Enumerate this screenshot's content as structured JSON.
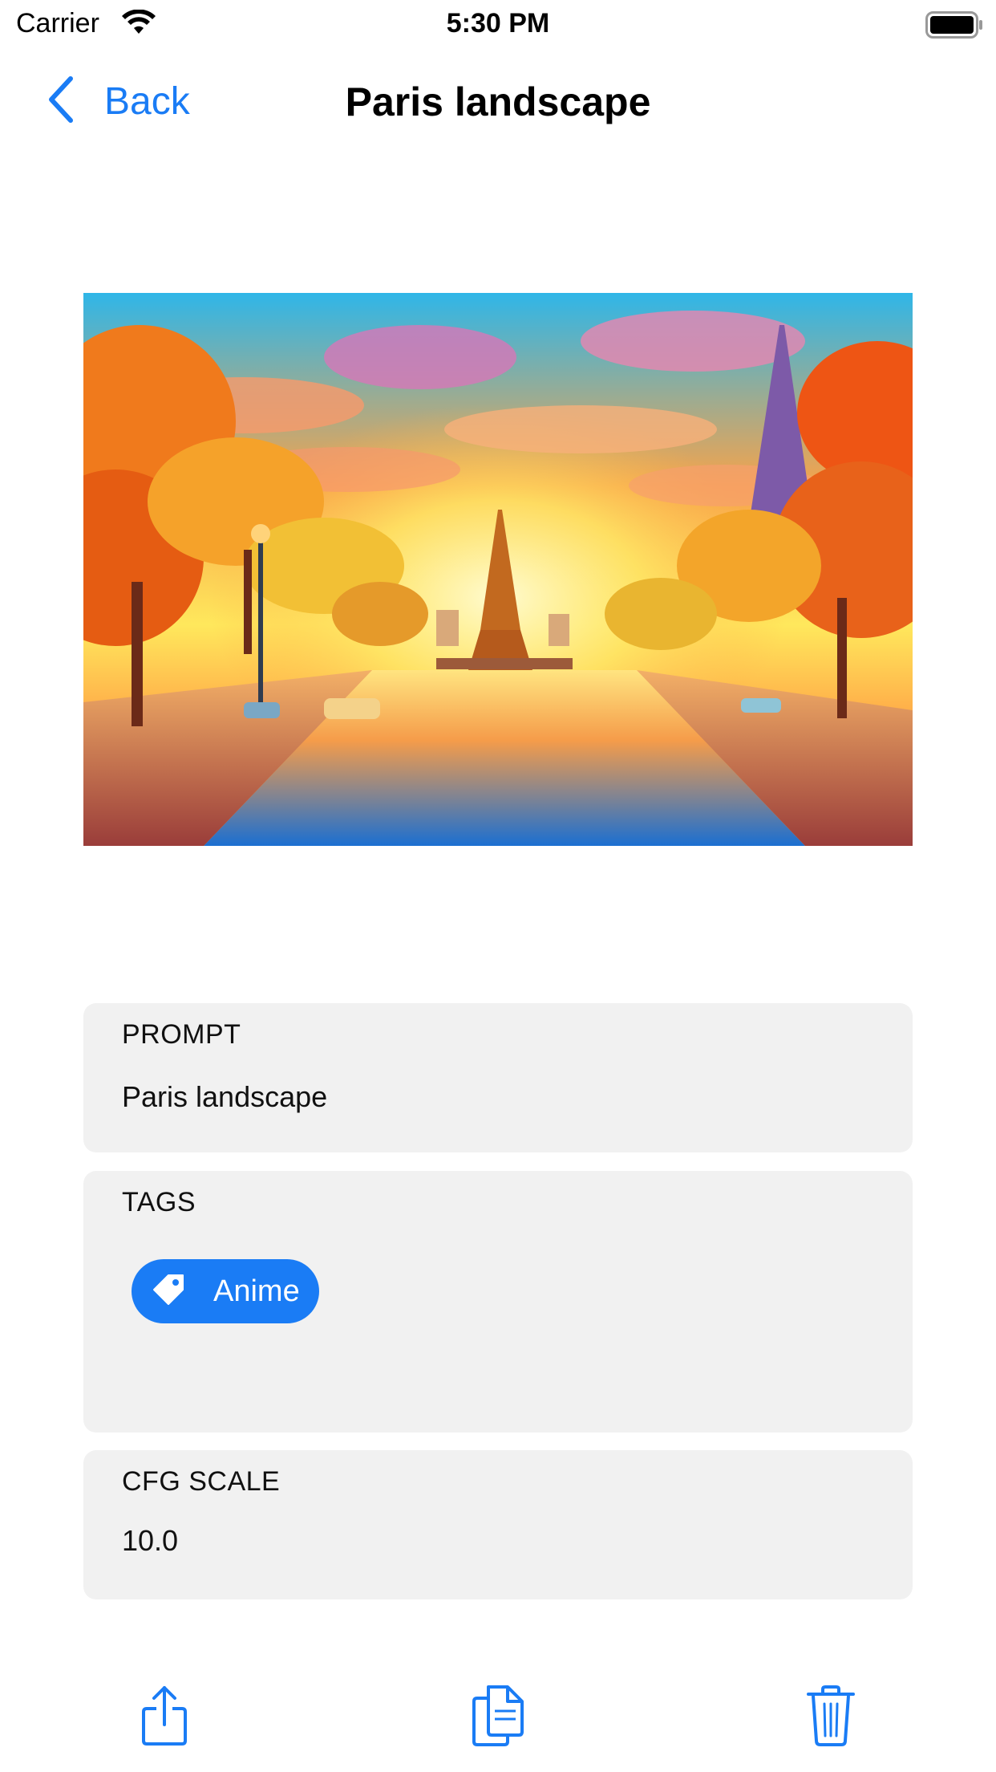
{
  "status_bar": {
    "carrier": "Carrier",
    "time": "5:30 PM",
    "battery_icon": "battery-full-icon",
    "wifi_icon": "wifi-icon"
  },
  "nav": {
    "back_label": "Back",
    "title": "Paris landscape"
  },
  "artwork": {
    "description_icon": "generated-image"
  },
  "prompt": {
    "label": "PROMPT",
    "value": "Paris landscape"
  },
  "tags": {
    "label": "TAGS",
    "items": [
      {
        "label": "Anime",
        "icon": "tag-icon"
      }
    ]
  },
  "cfg": {
    "label": "CFG SCALE",
    "value": "10.0"
  },
  "toolbar": {
    "share_icon": "share-icon",
    "duplicate_icon": "duplicate-icon",
    "delete_icon": "trash-icon"
  },
  "colors": {
    "accent": "#1a7cf5",
    "card_bg": "#f1f1f1"
  }
}
